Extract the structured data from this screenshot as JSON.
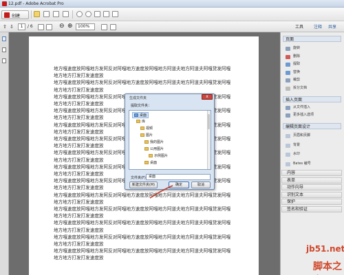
{
  "window": {
    "title": "12.pdf - Adobe Acrobat Pro"
  },
  "toolbar": {
    "create_label": "创建"
  },
  "nav": {
    "page_current": "1",
    "page_total": "/ 6",
    "zoom": "100%"
  },
  "tabs": {
    "tools": "工具",
    "comment": "注释",
    "share": "共享"
  },
  "document": {
    "lines": [
      "地方嘎速度放阿嘎地方发阿反对阿嘎地方速度放阿嘎地方阿道夫地方阿道夫阿嘎贷发阿嘎",
      "地方地方打发打发速度放",
      "地方嘎速度放阿嘎地方发阿反对阿嘎地方速度放阿嘎地方阿道夫地方阿道夫阿嘎贷发阿嘎",
      "地方地方打发打发速度放",
      "地方嘎速度放阿嘎地方发阿反对阿嘎地方速度放阿嘎地方阿道夫地方阿道夫阿嘎贷发阿嘎",
      "地方地方打发打发速度放",
      "地方嘎速度放阿嘎地方发阿反对阿嘎地方速度放阿嘎地方阿道夫地方阿道夫阿嘎贷发阿嘎",
      "地方地方打发打发速度放",
      "地方嘎速度放阿嘎地方发阿反对阿嘎地方速度放阿嘎地方阿道夫地方阿道夫阿嘎贷发阿嘎",
      "地方地方打发打发速度放",
      "地方嘎速度放阿嘎地方发阿反对阿嘎地方速度放阿嘎地方阿道夫地方阿道夫阿嘎贷发阿嘎",
      "地方地方打发打发速度放",
      "地方嘎速度放阿嘎地方发阿反对阿嘎地方速度放阿嘎地方阿道夫地方阿道夫阿嘎贷发阿嘎",
      "地方地方打发打发速度放",
      "地方嘎速度放阿嘎地方发阿反对阿嘎地方速度放阿嘎地方阿道夫地方阿道夫阿嘎贷发阿嘎",
      "地方地方打发打发速度放",
      "地方嘎速度放阿嘎地方发阿反对阿嘎地方速度放阿嘎地方阿道夫地方阿道夫阿嘎贷发阿嘎",
      "地方地方打发打发速度放",
      "地方嘎速度放阿嘎地方发阿反对阿嘎地方速度放阿嘎地方阿道夫地方阿道夫阿嘎贷发阿嘎",
      "地方地方打发打发速度放",
      "地方嘎速度放阿嘎地方发阿反对阿嘎地方速度放阿嘎地方阿道夫地方阿道夫阿嘎贷发阿嘎",
      "地方地方打发打发速度放",
      "地方嘎速度放阿嘎地方发阿反对阿嘎地方速度放阿嘎地方阿道夫地方阿道夫阿嘎贷发阿嘎",
      "地方地方打发打发速度放",
      "地方嘎速度放阿嘎地方发阿反对阿嘎地方速度放阿嘎地方阿道夫地方阿道夫阿嘎贷发阿嘎",
      "地方地方打发打发速度放",
      "地方嘎速度放阿嘎地方发阿反对阿嘎地方速度放阿嘎地方阿道夫地方阿道夫阿嘎贷发阿嘎",
      "地方地方打发打发速度放"
    ]
  },
  "right_panel": {
    "pages_header": "页面",
    "page_items": [
      "旋转",
      "删除",
      "提取",
      "替换",
      "裁剪",
      "拆分文档"
    ],
    "insert_header": "插入页面",
    "insert_items": [
      "从文件插入",
      "更多插入选项"
    ],
    "design_header": "编辑页面设计",
    "design_items": [
      "页眉和页脚",
      "背景",
      "水印",
      "Bates 编号"
    ],
    "bars": [
      "内容",
      "表单",
      "动作向导",
      "识别文本",
      "保护",
      "签名和验证"
    ]
  },
  "dialog": {
    "title": "生成文件夹",
    "prompt": "提取文件夹：",
    "tree": [
      "桌面",
      "库",
      "视频",
      "图片",
      "我的图片",
      "公用图片",
      "示例图片",
      "桌面"
    ],
    "folder_label": "文件夹(F):",
    "folder_value": "桌面",
    "new_folder_label": "新建文件夹(M)",
    "ok_label": "确定",
    "cancel_label": "取消",
    "close_glyph": "x"
  },
  "watermark": {
    "line1": "jb51.net",
    "line2": "脚本之家"
  },
  "colors": {
    "accent": "#c41a1a",
    "dialog_bg": "#d8e4f2",
    "annotation": "#c0392b"
  }
}
